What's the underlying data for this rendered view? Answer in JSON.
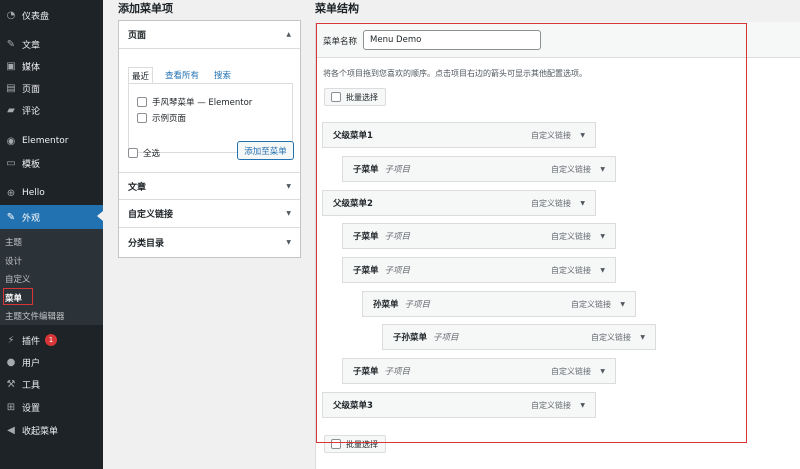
{
  "sidebar": {
    "items": [
      {
        "label": "仪表盘",
        "icon": "dashboard-icon",
        "glyph": "◔"
      },
      {
        "label": "文章",
        "icon": "pin-icon",
        "glyph": "✎"
      },
      {
        "label": "媒体",
        "icon": "media-icon",
        "glyph": "▣"
      },
      {
        "label": "页面",
        "icon": "page-icon",
        "glyph": "▤"
      },
      {
        "label": "评论",
        "icon": "comment-icon",
        "glyph": "▰"
      },
      {
        "label": "Elementor",
        "icon": "elementor-icon",
        "glyph": "◉"
      },
      {
        "label": "模板",
        "icon": "folder-icon",
        "glyph": "▭"
      },
      {
        "label": "Hello",
        "icon": "plus-circle-icon",
        "glyph": "⊕"
      },
      {
        "label": "外观",
        "icon": "brush-icon",
        "glyph": "✎"
      },
      {
        "label": "插件",
        "icon": "plugin-icon",
        "glyph": "⚡"
      },
      {
        "label": "用户",
        "icon": "user-icon",
        "glyph": "●"
      },
      {
        "label": "工具",
        "icon": "wrench-icon",
        "glyph": "⚒"
      },
      {
        "label": "设置",
        "icon": "settings-icon",
        "glyph": "⊞"
      },
      {
        "label": "收起菜单",
        "icon": "collapse-icon",
        "glyph": "◀"
      }
    ],
    "submenu": [
      "主题",
      "设计",
      "自定义",
      "菜单",
      "主题文件编辑器"
    ],
    "plugin_badge": "1"
  },
  "add_items": {
    "heading": "添加菜单项",
    "pages_title": "页面",
    "tabs": [
      "最近",
      "查看所有",
      "搜索"
    ],
    "pages": [
      "手风琴菜单 — Elementor",
      "示例页面"
    ],
    "select_all": "全选",
    "add_button": "添加至菜单",
    "sections": [
      "文章",
      "自定义链接",
      "分类目录"
    ]
  },
  "structure": {
    "heading": "菜单结构",
    "name_label": "菜单名称",
    "name_value": "Menu Demo",
    "instructions": "将各个项目拖到您喜欢的顺序。点击项目右边的箭头可显示其他配置选项。",
    "bulk_select": "批量选择",
    "type_label": "自定义链接",
    "sub_label": "子项目",
    "items": [
      {
        "title": "父级菜单1",
        "depth": 0,
        "sub": false
      },
      {
        "title": "子菜单",
        "depth": 1,
        "sub": true
      },
      {
        "title": "父级菜单2",
        "depth": 0,
        "sub": false
      },
      {
        "title": "子菜单",
        "depth": 1,
        "sub": true
      },
      {
        "title": "子菜单",
        "depth": 1,
        "sub": true
      },
      {
        "title": "孙菜单",
        "depth": 2,
        "sub": true
      },
      {
        "title": "子孙菜单",
        "depth": 3,
        "sub": true
      },
      {
        "title": "子菜单",
        "depth": 1,
        "sub": true
      },
      {
        "title": "父级菜单3",
        "depth": 0,
        "sub": false
      }
    ]
  }
}
